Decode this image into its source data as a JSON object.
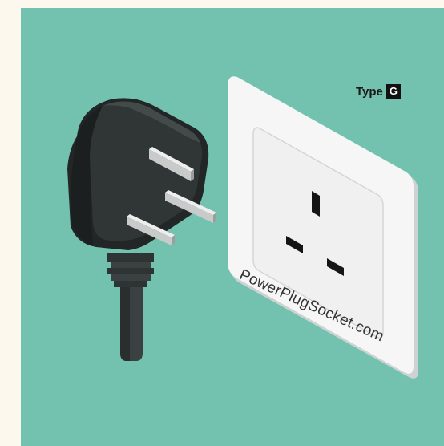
{
  "type_label": {
    "prefix": "Type",
    "letter": "G"
  },
  "watermark": {
    "text": "PowerPlugSocket.com"
  },
  "icons": {
    "plug": "uk-type-g-plug-icon",
    "socket": "uk-type-g-socket-icon"
  },
  "colors": {
    "background": "#73c2b0",
    "plug": "#2e3333",
    "socket": "#f4f4f4"
  }
}
